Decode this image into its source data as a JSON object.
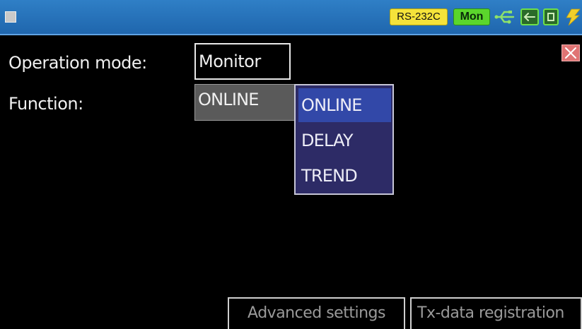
{
  "status_bar": {
    "interface_badge": "RS-232C",
    "mode_badge": "Mon",
    "icons": [
      "menu-icon",
      "usb-icon",
      "lan-icon",
      "sd-card-icon",
      "power-icon"
    ],
    "colors": {
      "bar": "#2470b8",
      "interface_badge": "#f5e33a",
      "mode_badge": "#5bd62c",
      "status_icon": "#6ee04a"
    }
  },
  "form": {
    "operation_mode": {
      "label": "Operation mode:",
      "value": "Monitor"
    },
    "function": {
      "label": "Function:",
      "value": "ONLINE"
    }
  },
  "dropdown": {
    "options": [
      "ONLINE",
      "DELAY",
      "TREND"
    ],
    "selected": "ONLINE",
    "colors": {
      "background": "#2d2b66",
      "highlight": "#3248a8"
    }
  },
  "close_button": {
    "icon": "close-icon",
    "color": "#e07474"
  },
  "footer": {
    "advanced_settings": "Advanced settings",
    "tx_data_registration": "Tx-data registration"
  }
}
